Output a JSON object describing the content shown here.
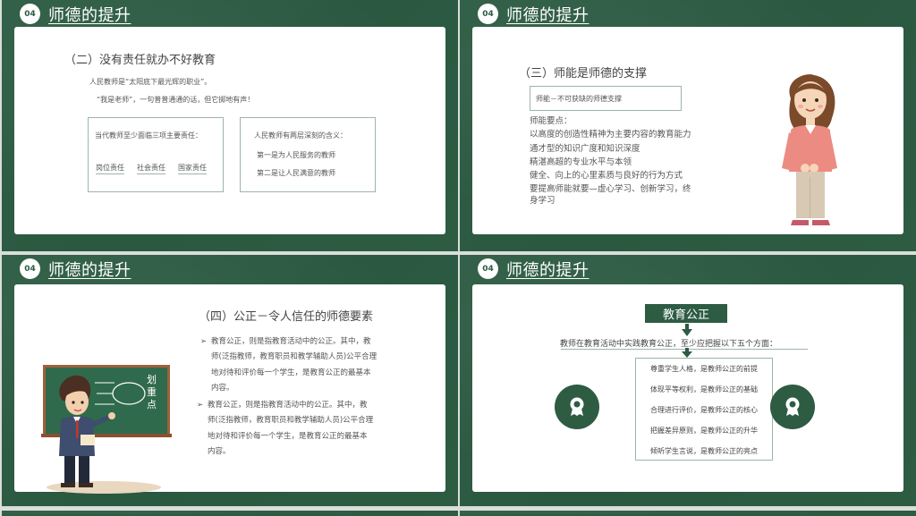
{
  "badge": "04",
  "section_title": "师德的提升",
  "slide1": {
    "heading": "（二）没有责任就办不好教育",
    "line1": "人民教师是“太阳底下最光辉的职业”。",
    "line2": "“我是老师”，一句普普通通的话，但它掷地有声！",
    "left_box": {
      "title": "当代教师至少面临三项主要责任：",
      "items": [
        "岗位责任",
        "社会责任",
        "国家责任"
      ]
    },
    "right_box": {
      "title": "人民教师有两层深刻的含义：",
      "items": [
        "第一是为人民服务的教师",
        "第二是让人民满意的教师"
      ]
    }
  },
  "slide2": {
    "heading": "（三）师能是师德的支撑",
    "box_text": "师能－不可获缺的师德支撑",
    "lines": [
      "师能要点：",
      "以高度的创造性精神为主要内容的教育能力",
      "通才型的知识广度和知识深度",
      "精湛高超的专业水平与本领",
      "健全、向上的心里素质与良好的行为方式",
      "要提高师能就要—虚心学习、创新学习，终",
      "身学习"
    ]
  },
  "slide3": {
    "heading": "（四）公正－令人信任的师德要素",
    "bullets": [
      [
        "教育公正，则是指教育活动中的公正。其中，教",
        "师(泛指教师，教育职员和教学辅助人员)公平合理",
        "地对待和评价每一个学生，是教育公正的最基本",
        "内容。"
      ],
      [
        "教育公正，则是指教育活动中的公正。其中，教",
        "师(泛指教师，教育职员和教学辅助人员)公平合理",
        "地对待和评价每一个学生，是教育公正的最基本",
        "内容。"
      ]
    ],
    "board_text": [
      "划",
      "重",
      "点"
    ]
  },
  "slide4": {
    "button": "教育公正",
    "intro": "教师在教育活动中实践教育公正，至少应把握以下五个方面：",
    "items": [
      "尊重学生人格，是教师公正的前提",
      "体现平等权利，是教师公正的基础",
      "合理进行评价，是教师公正的核心",
      "把握差异原则，是教师公正的升华",
      "倾听学生言说，是教师公正的亮点"
    ]
  },
  "colors": {
    "green": "#2d5c43",
    "border": "#9eb5a8"
  }
}
